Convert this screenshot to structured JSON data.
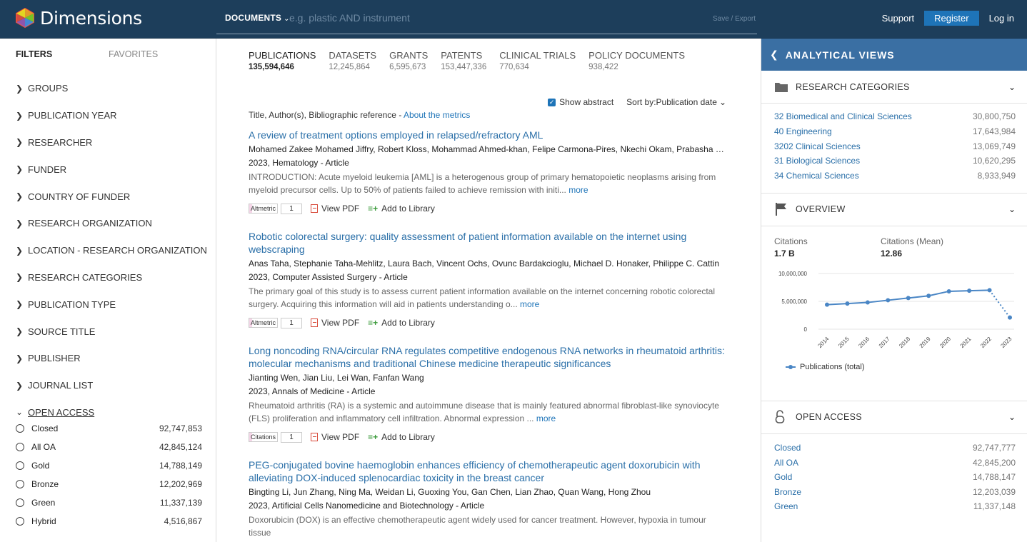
{
  "header": {
    "logo_text": "Dimensions",
    "search_scope": "DOCUMENTS",
    "search_placeholder": "e.g. plastic AND instrument",
    "save_export": "Save / Export",
    "support": "Support",
    "register": "Register",
    "login": "Log in"
  },
  "filters": {
    "tab_filters": "FILTERS",
    "tab_favorites": "FAVORITES",
    "items": [
      "GROUPS",
      "PUBLICATION YEAR",
      "RESEARCHER",
      "FUNDER",
      "COUNTRY OF FUNDER",
      "RESEARCH ORGANIZATION",
      "LOCATION - RESEARCH ORGANIZATION",
      "RESEARCH CATEGORIES",
      "PUBLICATION TYPE",
      "SOURCE TITLE",
      "PUBLISHER",
      "JOURNAL LIST",
      "OPEN ACCESS"
    ],
    "open_access": [
      {
        "name": "Closed",
        "count": "92,747,853"
      },
      {
        "name": "All OA",
        "count": "42,845,124"
      },
      {
        "name": "Gold",
        "count": "14,788,149"
      },
      {
        "name": "Bronze",
        "count": "12,202,969"
      },
      {
        "name": "Green",
        "count": "11,337,139"
      },
      {
        "name": "Hybrid",
        "count": "4,516,867"
      }
    ]
  },
  "doc_tabs": [
    {
      "label": "PUBLICATIONS",
      "count": "135,594,646"
    },
    {
      "label": "DATASETS",
      "count": "12,245,864"
    },
    {
      "label": "GRANTS",
      "count": "6,595,673"
    },
    {
      "label": "PATENTS",
      "count": "153,447,336"
    },
    {
      "label": "CLINICAL TRIALS",
      "count": "770,634"
    },
    {
      "label": "POLICY DOCUMENTS",
      "count": "938,422"
    }
  ],
  "controls": {
    "show_abstract": "Show abstract",
    "sort_label": "Sort by:",
    "sort_value": "Publication date"
  },
  "meta": {
    "text": "Title, Author(s), Bibliographic reference - ",
    "link": "About the metrics"
  },
  "results": [
    {
      "title": "A review of treatment options employed in relapsed/refractory AML",
      "authors": "Mohamed Zakee Mohamed Jiffry, Robert Kloss, Mohammad Ahmed-khan, Felipe Carmona-Pires, Nkechi Okam, Prabasha Weeraddana, Sakditat Ittiwut",
      "pub": "2023, Hematology - Article",
      "abstract": "INTRODUCTION: Acute myeloid leukemia [AML] is a heterogenous group of primary hematopoietic neoplasms arising from myeloid precursor cells. Up to 50% of patients failed to achieve remission with initi... ",
      "more": "more",
      "badge": "Altmetric",
      "badge_count": "1",
      "view_pdf": "View PDF",
      "add_library": "Add to Library"
    },
    {
      "title": "Robotic colorectal surgery: quality assessment of patient information available on the internet using webscraping",
      "authors": "Anas Taha, Stephanie Taha-Mehlitz, Laura Bach, Vincent Ochs, Ovunc Bardakcioglu, Michael D. Honaker, Philippe C. Cattin",
      "pub": "2023, Computer Assisted Surgery - Article",
      "abstract": "The primary goal of this study is to assess current patient information available on the internet concerning robotic colorectal surgery. Acquiring this information will aid in patients understanding o... ",
      "more": "more",
      "badge": "Altmetric",
      "badge_count": "1",
      "view_pdf": "View PDF",
      "add_library": "Add to Library"
    },
    {
      "title": "Long noncoding RNA/circular RNA regulates competitive endogenous RNA networks in rheumatoid arthritis: molecular mechanisms and traditional Chinese medicine therapeutic significances",
      "authors": "Jianting Wen, Jian Liu, Lei Wan, Fanfan Wang",
      "pub": "2023, Annals of Medicine - Article",
      "abstract": "Rheumatoid arthritis (RA) is a systemic and autoimmune disease that is mainly featured abnormal fibroblast-like synoviocyte (FLS) proliferation and inflammatory cell infiltration. Abnormal expression ... ",
      "more": "more",
      "badge": "Citations",
      "badge_count": "1",
      "view_pdf": "View PDF",
      "add_library": "Add to Library"
    },
    {
      "title": "PEG-conjugated bovine haemoglobin enhances efficiency of chemotherapeutic agent doxorubicin with alleviating DOX-induced splenocardiac toxicity in the breast cancer",
      "authors": "Bingting Li, Jun Zhang, Ning Ma, Weidan Li, Guoxing You, Gan Chen, Lian Zhao, Quan Wang, Hong Zhou",
      "pub": "2023, Artificial Cells Nanomedicine and Biotechnology - Article",
      "abstract": "Doxorubicin (DOX) is an effective chemotherapeutic agent widely used for cancer treatment. However, hypoxia in tumour tissue",
      "more": "",
      "badge": "",
      "badge_count": "",
      "view_pdf": "",
      "add_library": ""
    }
  ],
  "panel": {
    "title": "ANALYTICAL VIEWS",
    "research_categories_label": "RESEARCH CATEGORIES",
    "categories": [
      {
        "name": "32 Biomedical and Clinical Sciences",
        "value": "30,800,750"
      },
      {
        "name": "40 Engineering",
        "value": "17,643,984"
      },
      {
        "name": "3202 Clinical Sciences",
        "value": "13,069,749"
      },
      {
        "name": "31 Biological Sciences",
        "value": "10,620,295"
      },
      {
        "name": "34 Chemical Sciences",
        "value": "8,933,949"
      }
    ],
    "overview_label": "OVERVIEW",
    "citations_label": "Citations",
    "citations_value": "1.7 B",
    "citations_mean_label": "Citations (Mean)",
    "citations_mean_value": "12.86",
    "open_access_label": "OPEN ACCESS",
    "open_access": [
      {
        "name": "Closed",
        "value": "92,747,777"
      },
      {
        "name": "All OA",
        "value": "42,845,200"
      },
      {
        "name": "Gold",
        "value": "14,788,147"
      },
      {
        "name": "Bronze",
        "value": "12,203,039"
      },
      {
        "name": "Green",
        "value": "11,337,148"
      }
    ]
  },
  "chart_data": {
    "type": "line",
    "x": [
      "2014",
      "2015",
      "2016",
      "2017",
      "2018",
      "2019",
      "2020",
      "2021",
      "2022",
      "2023"
    ],
    "series": [
      {
        "name": "Publications (total)",
        "values": [
          4400000,
          4600000,
          4800000,
          5200000,
          5600000,
          6000000,
          6800000,
          6900000,
          7000000,
          2100000
        ]
      }
    ],
    "yticks": [
      "10,000,000",
      "5,000,000",
      "0"
    ],
    "ylim": [
      0,
      10000000
    ],
    "grid": true,
    "legend": "bottom-left"
  },
  "colors": {
    "header_bg": "#1d3e5b",
    "panel_header": "#3a6fa3",
    "link": "#2a6fa8",
    "accent": "#1e74b8",
    "series": "#4a86c5"
  }
}
